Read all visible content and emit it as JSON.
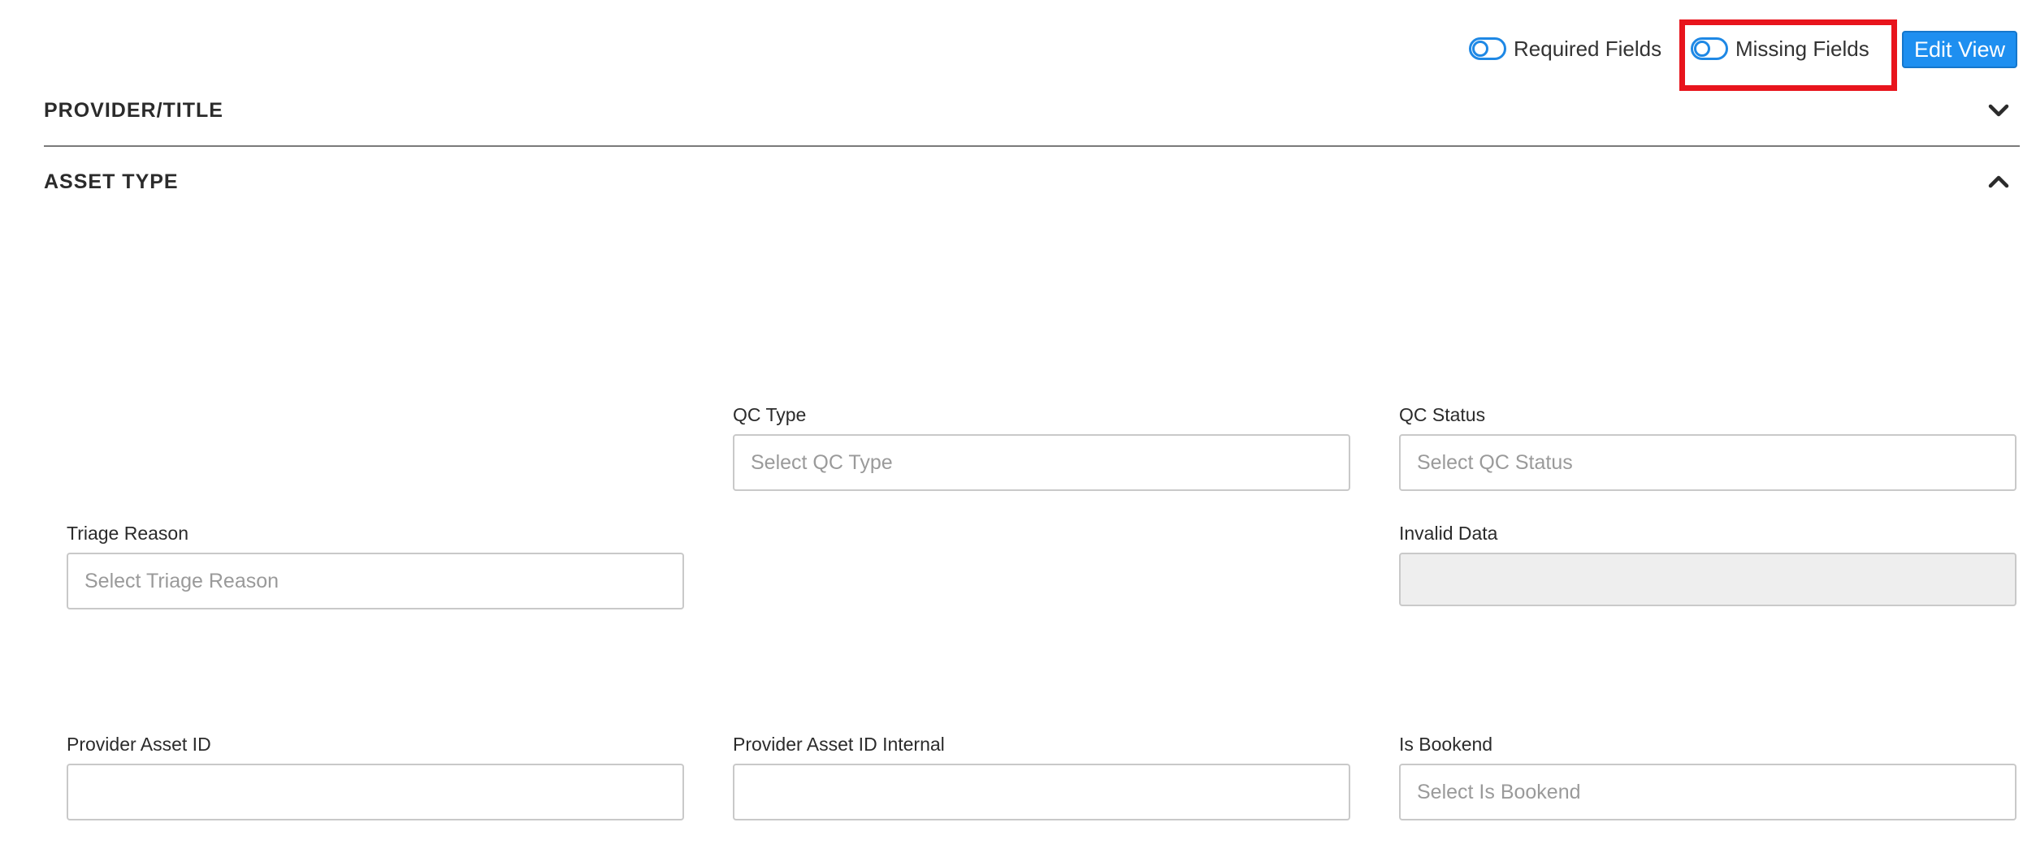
{
  "toolbar": {
    "required_fields_label": "Required Fields",
    "missing_fields_label": "Missing Fields",
    "edit_view_label": "Edit View"
  },
  "colors": {
    "accent": "#1e88e5",
    "button": "#1e8ff0",
    "highlight": "#e8141c"
  },
  "sections": {
    "provider_title": {
      "title": "PROVIDER/TITLE",
      "state": "collapsed",
      "icon": "chevron-down-icon"
    },
    "asset_type": {
      "title": "ASSET TYPE",
      "state": "expanded",
      "icon": "chevron-up-icon"
    }
  },
  "fields": {
    "qc_type": {
      "label": "QC Type",
      "placeholder": "Select QC Type",
      "value": ""
    },
    "qc_status": {
      "label": "QC Status",
      "placeholder": "Select QC Status",
      "value": ""
    },
    "triage_reason": {
      "label": "Triage Reason",
      "placeholder": "Select Triage Reason",
      "value": ""
    },
    "invalid_data": {
      "label": "Invalid Data",
      "placeholder": "",
      "value": ""
    },
    "provider_asset_id": {
      "label": "Provider Asset ID",
      "placeholder": "",
      "value": ""
    },
    "provider_asset_id_internal": {
      "label": "Provider Asset ID Internal",
      "placeholder": "",
      "value": ""
    },
    "is_bookend": {
      "label": "Is Bookend",
      "placeholder": "Select Is Bookend",
      "value": ""
    }
  }
}
